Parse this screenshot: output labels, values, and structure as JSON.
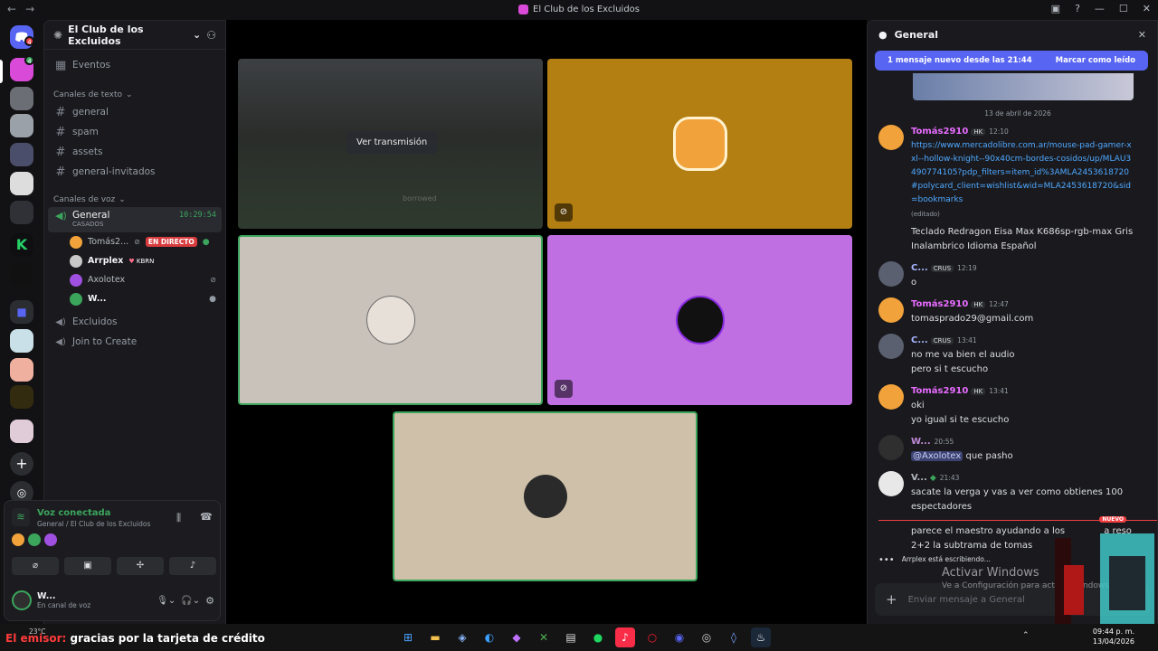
{
  "window": {
    "title": "El Club de los Excluidos"
  },
  "rail": {
    "dm_badge": "4",
    "new_badge": "4"
  },
  "server": {
    "name": "El Club de los Excluidos"
  },
  "channels": {
    "events": "Eventos",
    "text_category": "Canales de texto",
    "text": [
      "general",
      "spam",
      "assets",
      "general-invitados"
    ],
    "voice_category": "Canales de voz",
    "voice_active": {
      "name": "General",
      "timer": "10:29:54",
      "status": "CASADOS"
    },
    "members": [
      {
        "name": "Tomás2...",
        "live": "EN DIRECTO"
      },
      {
        "name": "Arrplex",
        "tag": "KBRN"
      },
      {
        "name": "Axolotex"
      },
      {
        "name": "W..."
      }
    ],
    "voice_other": [
      "Excluidos",
      "Join to Create"
    ]
  },
  "voice_panel": {
    "status": "Voz conectada",
    "location": "General / El Club de los Excluidos",
    "user": "W...",
    "user_status": "En canal de voz"
  },
  "stage": {
    "watch_stream": "Ver transmisión",
    "faint_stream_text": "borrowed"
  },
  "chat": {
    "title": "General",
    "new_banner": "1 mensaje nuevo desde las 21:44",
    "mark_read": "Marcar como leído",
    "date": "13 de abril de 2026",
    "messages": [
      {
        "author": "Tomás2910",
        "tag": "HK",
        "time": "12:10",
        "link": "https://www.mercadolibre.com.ar/mouse-pad-gamer-xxl--hollow-knight--90x40cm-bordes-cosidos/up/MLAU3490774105?pdp_filters=item_id%3AMLA2453618720#polycard_client=wishlist&wid=MLA2453618720&sid=bookmarks",
        "edited": "(editado)",
        "text": "Teclado Redragon Eisa Max K686sp-rgb-max Gris Inalambrico Idioma Español"
      },
      {
        "author": "C...",
        "tag": "CRUS",
        "time": "12:19",
        "text": "o"
      },
      {
        "author": "Tomás2910",
        "tag": "HK",
        "time": "12:47",
        "text": "tomasprado29@gmail.com"
      },
      {
        "author": "C...",
        "tag": "CRUS",
        "time": "13:41",
        "text": "no me va bien el audio",
        "text2": "pero si t escucho"
      },
      {
        "author": "Tomás2910",
        "tag": "HK",
        "time": "13:41",
        "text": "oki",
        "text2": "yo igual si te escucho"
      },
      {
        "author": "W...",
        "time": "20:55",
        "mention": "@Axolotex",
        "text": "que pasho"
      },
      {
        "author": "V...",
        "time": "21:43",
        "text": "sacate la verga y vas a ver como obtienes 100 espectadores"
      },
      {
        "text": "parece el maestro ayudando a los",
        "text_end": "a reso",
        "text2": "2+2 la subtrama de tomas"
      }
    ],
    "new_label": "NUEVO",
    "typing": "Arrplex está escribiendo...",
    "composer_placeholder": "Enviar mensaje a General"
  },
  "os": {
    "watermark": "Activar Windows",
    "watermark_sub": "Ve a Configuración para activar Windows.",
    "caption_red": "El emisor:",
    "caption": "gracias por la tarjeta de crédito",
    "weather": "23°C",
    "time": "09:44 p. m.",
    "date": "13/04/2026"
  }
}
